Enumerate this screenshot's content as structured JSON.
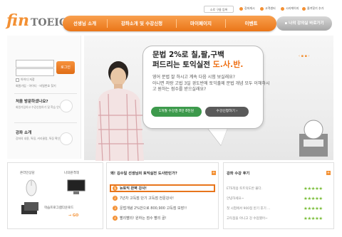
{
  "header": {
    "logo_fin": "fin",
    "logo_toeic": "TOEIC",
    "bookmark": "소로 구름 등록",
    "toplinks": [
      "강좌게시",
      "고객센터",
      "시리케이지",
      "즐겨찾기 추가"
    ]
  },
  "nav": {
    "items": [
      "선생님 소개",
      "강좌소개 및 수강신청",
      "마이페이지",
      "이벤트"
    ],
    "my_lecture": "나의 강의실 바로가기"
  },
  "login": {
    "login_button": "로그인",
    "remember": "아이디 저장",
    "links": "회원가입 · 아이디 · 비밀번호 찾기"
  },
  "sidebar": {
    "first_visit_title": "처음 방문하셨나요?",
    "first_visit_desc": "회원가입하고 수강신청하기 및 학습 안내",
    "course_title": "강좌 소개",
    "course_desc": "강좌의 내용, 특징, 커리큘럼, 특징 확인하기"
  },
  "hero": {
    "headline_l1": "문법 2%로 칠,팔,구백",
    "headline_l2a": "퍼드리는 토익실전 ",
    "headline_l2b": "도.사.반.",
    "body": "영어 문법 잘 하시고 계속 다음 시험 보실래요?\n아니면 저랑 고법 3일 경도반에 토익출제 문법 개념 모두 이해하시고 원하는 점수를 받으실래요?",
    "btn_price": "1개월 수강권 8만 8천원",
    "btn_apply": "수강신청하기 ›",
    "carousel": "‹ ▪ ▪ ›"
  },
  "services": {
    "online_consult": "온라인상담",
    "remote_support": "나의원격데",
    "download_title": "학습프로그램다운로드",
    "go": "→ GO"
  },
  "notice": {
    "title": "왜! 김수일 선생님의 토익실전 도사반인가?",
    "items": [
      "뉴토익 완벽 강사!",
      "7년차 고득점 단기 고득점 전문강사!",
      "문법개념 2%만으로 800,900 고득점 보장!!",
      "빨리빨리! 원하는 점수 빨리 골!"
    ],
    "nums": [
      "1",
      "2",
      "3",
      "4"
    ]
  },
  "reviews": {
    "title": "강좌 수강 후기",
    "items": [
      "ETS적용 토트익도반 불다.",
      "안녕하세요~",
      "첫 시험에서 900점 받기 후기 ...",
      "고득점을 아니고 강 수업했어~"
    ]
  },
  "colors": {
    "accent": "#f39033",
    "green": "#3d9a4c",
    "highlight_border": "#e8751c"
  }
}
